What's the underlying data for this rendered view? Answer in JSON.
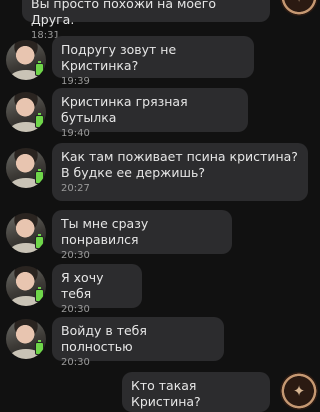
{
  "messages": [
    {
      "text": "Вы просто похожи на моего Друга.",
      "time": "18:31"
    },
    {
      "text": "Подругу зовут не Кристинка?",
      "time": "19:39"
    },
    {
      "text": "Кристинка грязная бутылка",
      "time": "19:40"
    },
    {
      "text": "Как там поживает псина кристина? В будке ее держишь?",
      "time": "20:27"
    },
    {
      "text": "Ты мне сразу понравился",
      "time": "20:30"
    },
    {
      "text": "Я хочу тебя",
      "time": "20:30"
    },
    {
      "text": "Войду в тебя полностью",
      "time": "20:30"
    },
    {
      "text": "Кто такая Кристина?",
      "time": ""
    }
  ],
  "icons": {
    "contact_avatar": "user-avatar-icon",
    "battery": "battery-icon",
    "own_avatar": "brand-logo-icon"
  }
}
